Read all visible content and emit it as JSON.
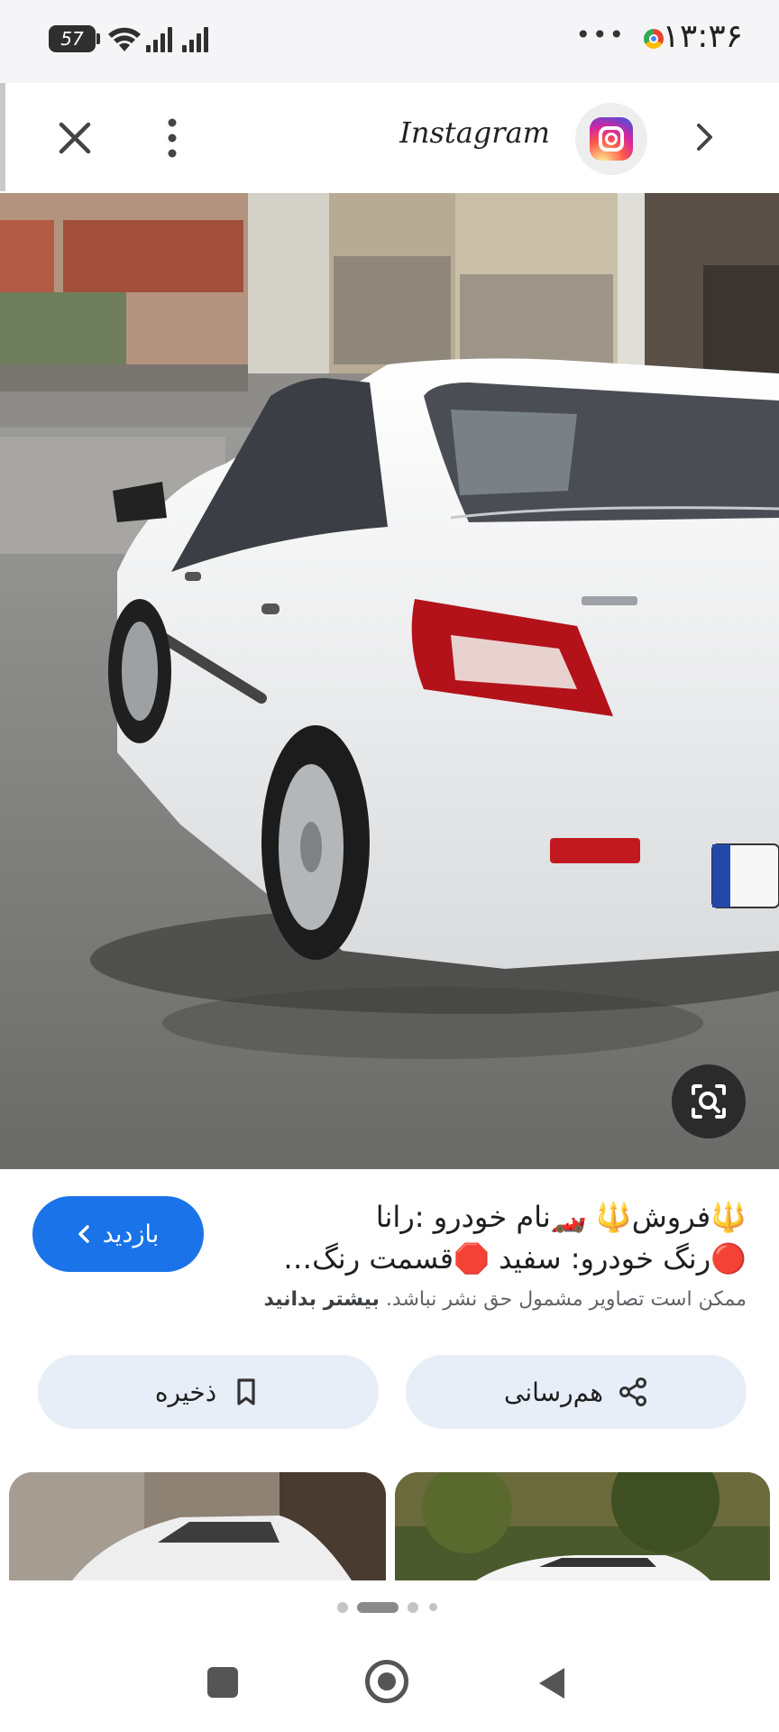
{
  "status_bar": {
    "time": "۱۳:۳۶",
    "battery_level": "57",
    "overflow_dots": "•••",
    "icons": [
      "chrome-icon",
      "wifi-icon",
      "signal-icon",
      "signal-icon"
    ]
  },
  "header": {
    "source_title": "Instagram",
    "source_icon": "instagram-icon",
    "close_icon": "close-icon",
    "more_icon": "more-vert-icon",
    "next_icon": "chevron-right-icon"
  },
  "image": {
    "lens_button_icon": "lens-search-icon"
  },
  "result": {
    "visit_label": "بازدید",
    "caption_line1": "🔱فروش🔱 🏎️نام خودرو :رانا",
    "caption_line2": "🔴رنگ خودرو: سفید 🛑قسمت رنگ…",
    "copyright_text": "ممکن است تصاویر مشمول حق نشر نباشد.",
    "learn_more": "بیشتر بدانید"
  },
  "actions": {
    "share_label": "هم‌رسانی",
    "save_label": "ذخیره"
  },
  "pager": {
    "count": 4,
    "active_index": 1
  },
  "colors": {
    "accent": "#1a73e8",
    "action_button_bg": "#e8eef8",
    "status_bar_bg": "#f5f5f7"
  }
}
